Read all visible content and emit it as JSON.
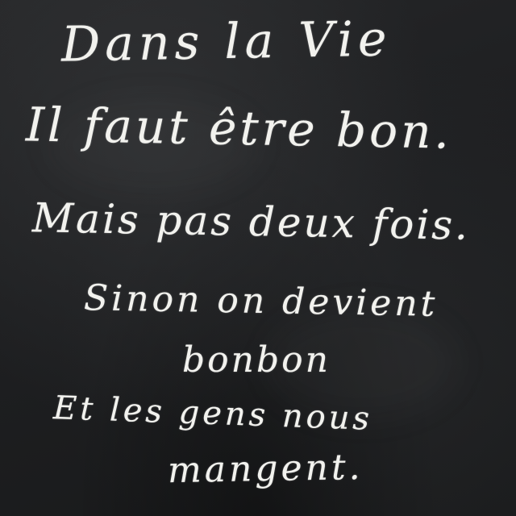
{
  "chalkboard": {
    "lines": [
      "Dans la Vie",
      "Il faut être bon.",
      "Mais pas deux fois.",
      "Sinon on devient",
      "bonbon",
      "Et les gens nous",
      "mangent."
    ]
  },
  "colors": {
    "board": "#1e1f21",
    "chalk": "#f2f2ee"
  }
}
